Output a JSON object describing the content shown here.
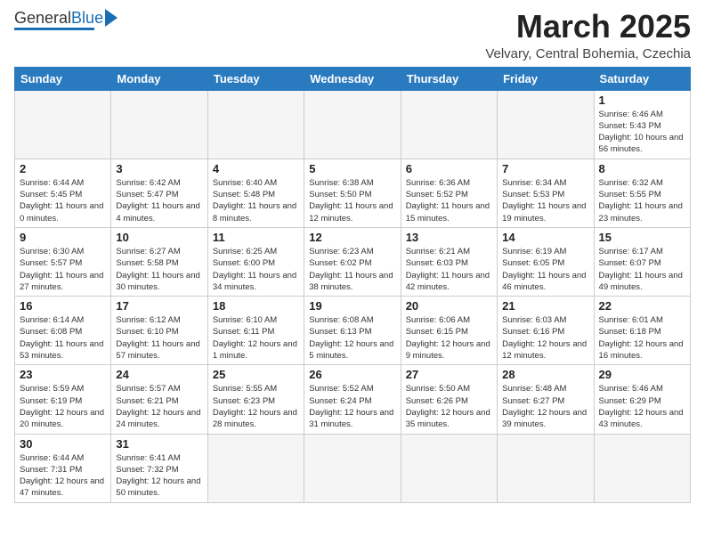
{
  "header": {
    "logo_general": "General",
    "logo_blue": "Blue",
    "title": "March 2025",
    "subtitle": "Velvary, Central Bohemia, Czechia"
  },
  "weekdays": [
    "Sunday",
    "Monday",
    "Tuesday",
    "Wednesday",
    "Thursday",
    "Friday",
    "Saturday"
  ],
  "weeks": [
    [
      {
        "day": "",
        "empty": true
      },
      {
        "day": "",
        "empty": true
      },
      {
        "day": "",
        "empty": true
      },
      {
        "day": "",
        "empty": true
      },
      {
        "day": "",
        "empty": true
      },
      {
        "day": "",
        "empty": true
      },
      {
        "day": "1",
        "info": "Sunrise: 6:46 AM\nSunset: 5:43 PM\nDaylight: 10 hours\nand 56 minutes."
      }
    ],
    [
      {
        "day": "2",
        "info": "Sunrise: 6:44 AM\nSunset: 5:45 PM\nDaylight: 11 hours\nand 0 minutes."
      },
      {
        "day": "3",
        "info": "Sunrise: 6:42 AM\nSunset: 5:47 PM\nDaylight: 11 hours\nand 4 minutes."
      },
      {
        "day": "4",
        "info": "Sunrise: 6:40 AM\nSunset: 5:48 PM\nDaylight: 11 hours\nand 8 minutes."
      },
      {
        "day": "5",
        "info": "Sunrise: 6:38 AM\nSunset: 5:50 PM\nDaylight: 11 hours\nand 12 minutes."
      },
      {
        "day": "6",
        "info": "Sunrise: 6:36 AM\nSunset: 5:52 PM\nDaylight: 11 hours\nand 15 minutes."
      },
      {
        "day": "7",
        "info": "Sunrise: 6:34 AM\nSunset: 5:53 PM\nDaylight: 11 hours\nand 19 minutes."
      },
      {
        "day": "8",
        "info": "Sunrise: 6:32 AM\nSunset: 5:55 PM\nDaylight: 11 hours\nand 23 minutes."
      }
    ],
    [
      {
        "day": "9",
        "info": "Sunrise: 6:30 AM\nSunset: 5:57 PM\nDaylight: 11 hours\nand 27 minutes."
      },
      {
        "day": "10",
        "info": "Sunrise: 6:27 AM\nSunset: 5:58 PM\nDaylight: 11 hours\nand 30 minutes."
      },
      {
        "day": "11",
        "info": "Sunrise: 6:25 AM\nSunset: 6:00 PM\nDaylight: 11 hours\nand 34 minutes."
      },
      {
        "day": "12",
        "info": "Sunrise: 6:23 AM\nSunset: 6:02 PM\nDaylight: 11 hours\nand 38 minutes."
      },
      {
        "day": "13",
        "info": "Sunrise: 6:21 AM\nSunset: 6:03 PM\nDaylight: 11 hours\nand 42 minutes."
      },
      {
        "day": "14",
        "info": "Sunrise: 6:19 AM\nSunset: 6:05 PM\nDaylight: 11 hours\nand 46 minutes."
      },
      {
        "day": "15",
        "info": "Sunrise: 6:17 AM\nSunset: 6:07 PM\nDaylight: 11 hours\nand 49 minutes."
      }
    ],
    [
      {
        "day": "16",
        "info": "Sunrise: 6:14 AM\nSunset: 6:08 PM\nDaylight: 11 hours\nand 53 minutes."
      },
      {
        "day": "17",
        "info": "Sunrise: 6:12 AM\nSunset: 6:10 PM\nDaylight: 11 hours\nand 57 minutes."
      },
      {
        "day": "18",
        "info": "Sunrise: 6:10 AM\nSunset: 6:11 PM\nDaylight: 12 hours\nand 1 minute."
      },
      {
        "day": "19",
        "info": "Sunrise: 6:08 AM\nSunset: 6:13 PM\nDaylight: 12 hours\nand 5 minutes."
      },
      {
        "day": "20",
        "info": "Sunrise: 6:06 AM\nSunset: 6:15 PM\nDaylight: 12 hours\nand 9 minutes."
      },
      {
        "day": "21",
        "info": "Sunrise: 6:03 AM\nSunset: 6:16 PM\nDaylight: 12 hours\nand 12 minutes."
      },
      {
        "day": "22",
        "info": "Sunrise: 6:01 AM\nSunset: 6:18 PM\nDaylight: 12 hours\nand 16 minutes."
      }
    ],
    [
      {
        "day": "23",
        "info": "Sunrise: 5:59 AM\nSunset: 6:19 PM\nDaylight: 12 hours\nand 20 minutes."
      },
      {
        "day": "24",
        "info": "Sunrise: 5:57 AM\nSunset: 6:21 PM\nDaylight: 12 hours\nand 24 minutes."
      },
      {
        "day": "25",
        "info": "Sunrise: 5:55 AM\nSunset: 6:23 PM\nDaylight: 12 hours\nand 28 minutes."
      },
      {
        "day": "26",
        "info": "Sunrise: 5:52 AM\nSunset: 6:24 PM\nDaylight: 12 hours\nand 31 minutes."
      },
      {
        "day": "27",
        "info": "Sunrise: 5:50 AM\nSunset: 6:26 PM\nDaylight: 12 hours\nand 35 minutes."
      },
      {
        "day": "28",
        "info": "Sunrise: 5:48 AM\nSunset: 6:27 PM\nDaylight: 12 hours\nand 39 minutes."
      },
      {
        "day": "29",
        "info": "Sunrise: 5:46 AM\nSunset: 6:29 PM\nDaylight: 12 hours\nand 43 minutes."
      }
    ],
    [
      {
        "day": "30",
        "info": "Sunrise: 6:44 AM\nSunset: 7:31 PM\nDaylight: 12 hours\nand 47 minutes."
      },
      {
        "day": "31",
        "info": "Sunrise: 6:41 AM\nSunset: 7:32 PM\nDaylight: 12 hours\nand 50 minutes."
      },
      {
        "day": "",
        "empty": true
      },
      {
        "day": "",
        "empty": true
      },
      {
        "day": "",
        "empty": true
      },
      {
        "day": "",
        "empty": true
      },
      {
        "day": "",
        "empty": true
      }
    ]
  ]
}
